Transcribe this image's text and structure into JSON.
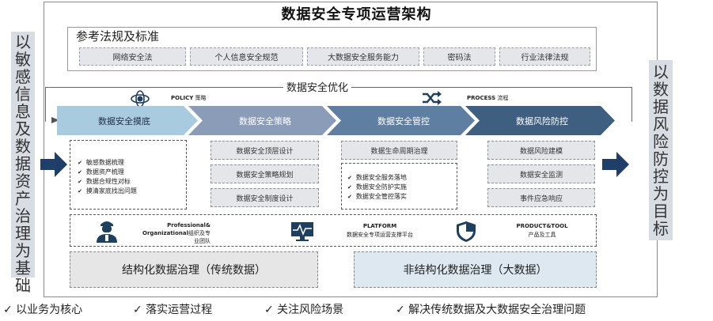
{
  "title": "数据安全专项运营架构",
  "left_side": [
    "以",
    "敏",
    "感",
    "信",
    "息",
    "及",
    "数",
    "据",
    "资",
    "产",
    "治",
    "理",
    "为",
    "基",
    "础"
  ],
  "right_side": [
    "以",
    "数",
    "据",
    "风",
    "险",
    "防",
    "控",
    "为",
    "目",
    "标"
  ],
  "reference": {
    "title": "参考法规及标准",
    "items": [
      "网络安全法",
      "个人信息安全规范",
      "大数据安全服务能力",
      "密码法",
      "行业法律法规"
    ]
  },
  "optimization_label": "数据安全优化",
  "policy": {
    "en": "POLICY",
    "cn": "策略"
  },
  "process": {
    "en": "PROCESS",
    "cn": "流程"
  },
  "stages": [
    "数据安全摸底",
    "数据安全策略",
    "数据安全管控",
    "数据风险防控"
  ],
  "stage_colors": [
    "#a9cbe0",
    "#8a9cb8",
    "#5f7fa2",
    "#3f5f80"
  ],
  "col1_bullets": [
    "敏感数据梳理",
    "数据资产梳理",
    "数据合规性对标",
    "摸清家底找出问题"
  ],
  "col2_items": [
    "数据安全顶层设计",
    "数据安全策略规划",
    "数据安全制度设计"
  ],
  "col3_top": "数据生命周期治理",
  "col3_bullets": [
    "数据安全服务落地",
    "数据安全防护实施",
    "数据安全管控落实"
  ],
  "col4_items": [
    "数据风险建模",
    "数据安全监测",
    "事件应急响应"
  ],
  "platform_row": {
    "professional": {
      "en": "Professional&",
      "en2": "Organizational",
      "cn": "组织及专业团队"
    },
    "platform": {
      "en": "PLATFORM",
      "cn": "数据安全专项运营支撑平台"
    },
    "product": {
      "en": "PRODUCT&TOOL",
      "cn": "产品及工具"
    }
  },
  "governance": [
    "结构化数据治理（传统数据）",
    "非结构化数据治理（大数据）"
  ],
  "governance_colors": [
    "#e6e6e6",
    "#dde8f1"
  ],
  "footer": [
    "✓ 以业务为核心",
    "✓ 落实运营过程",
    "✓ 关注风险场景",
    "✓ 解决传统数据及大数据安全治理问题"
  ],
  "icon_color": "#1f3f5f"
}
